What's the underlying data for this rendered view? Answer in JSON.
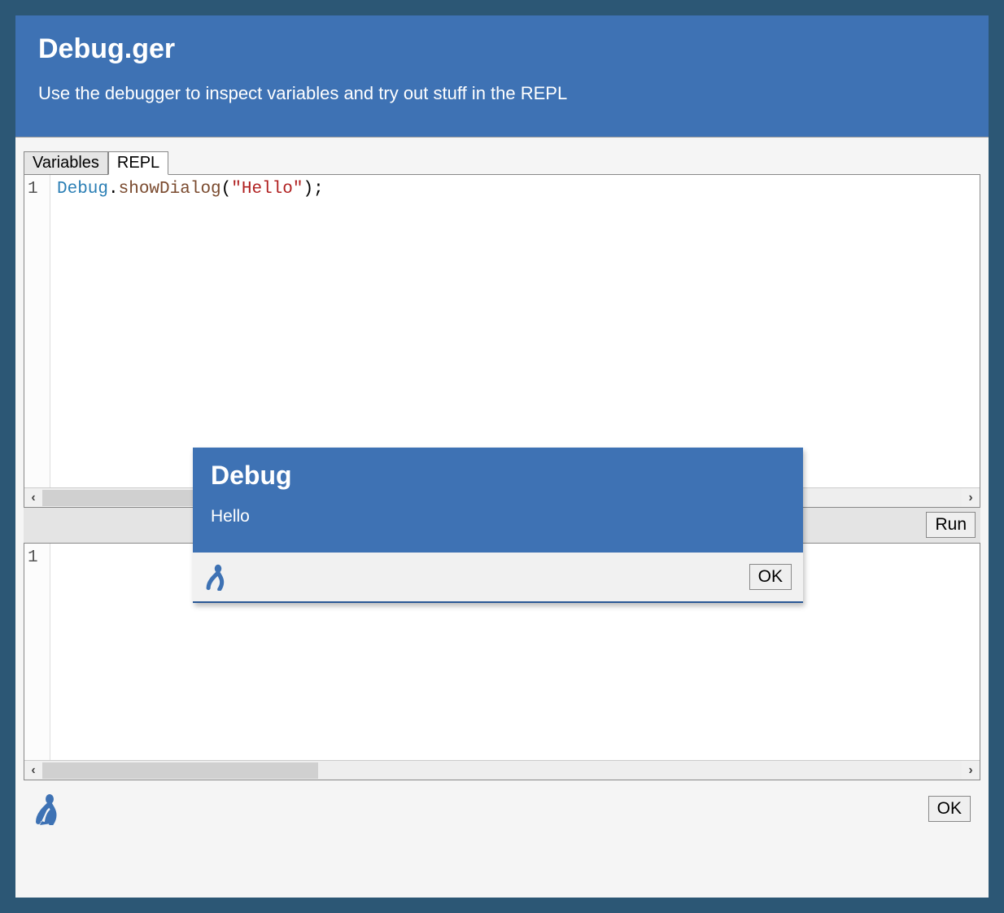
{
  "header": {
    "title": "Debug.ger",
    "subtitle": "Use the debugger to inspect variables and try out stuff in the REPL"
  },
  "tabs": {
    "variables_label": "Variables",
    "repl_label": "REPL",
    "active": "repl"
  },
  "editor": {
    "gutter_1": "1",
    "code_tokens": {
      "cls": "Debug",
      "dot": ".",
      "method": "showDialog",
      "lparen": "(",
      "string": "\"Hello\"",
      "rparen_semicolon": ");"
    }
  },
  "scroll": {
    "left_arrow": "‹",
    "right_arrow": "›"
  },
  "run_bar": {
    "run_label": "Run"
  },
  "output": {
    "gutter_1": "1"
  },
  "footer": {
    "ok_label": "OK"
  },
  "dialog": {
    "title": "Debug",
    "message": "Hello",
    "ok_label": "OK"
  },
  "icons": {
    "logo": "servoy-logo-icon"
  }
}
